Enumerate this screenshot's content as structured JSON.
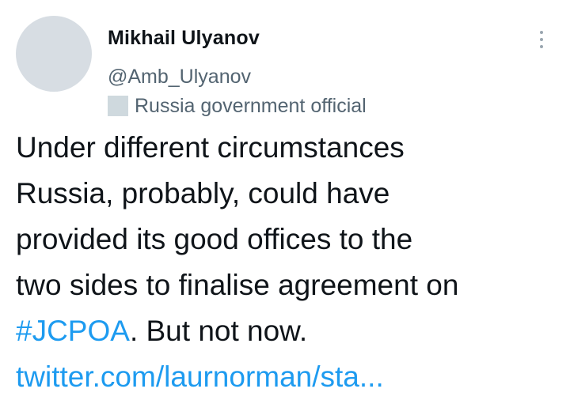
{
  "tweet": {
    "author": {
      "name": "Mikhail Ulyanov",
      "handle": "@Amb_Ulyanov",
      "label": "Russia government official"
    },
    "text": {
      "line1": "Under different circumstances",
      "line2": "Russia, probably, could have",
      "line3": "provided its good offices to the",
      "line4": "two sides to finalise agreement on",
      "hashtag": "#JCPOA",
      "after_hashtag": ". But not now.",
      "link": "twitter.com/laurnorman/sta..."
    }
  },
  "icons": {
    "more": "more-vertical-icon",
    "label": "flag-icon"
  },
  "colors": {
    "text": "#0f1419",
    "secondary": "#536471",
    "link": "#1d9bf0",
    "avatar": "#d7dde3"
  }
}
